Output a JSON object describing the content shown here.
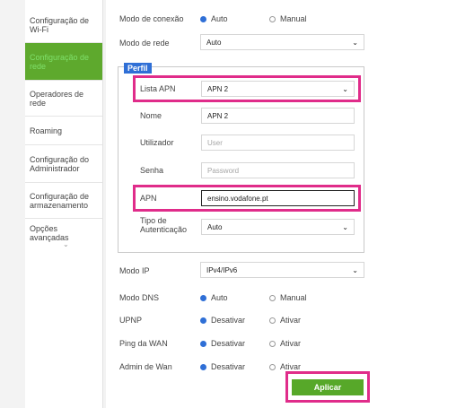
{
  "sidebar": {
    "items": [
      {
        "label": "Configuração de Wi-Fi"
      },
      {
        "label": "Configuração de rede"
      },
      {
        "label": "Operadores de rede"
      },
      {
        "label": "Roaming"
      },
      {
        "label": "Configuração do Administrador"
      },
      {
        "label": "Configuração de armazenamento"
      },
      {
        "label": "Opções avançadas"
      }
    ]
  },
  "form": {
    "connection_mode": {
      "label": "Modo de conexão",
      "options": [
        "Auto",
        "Manual"
      ],
      "selected": "Auto"
    },
    "network_mode": {
      "label": "Modo de rede",
      "value": "Auto"
    },
    "profile": {
      "legend": "Perfil",
      "apn_list": {
        "label": "Lista APN",
        "value": "APN 2"
      },
      "name": {
        "label": "Nome",
        "value": "APN 2"
      },
      "user": {
        "label": "Utilizador",
        "placeholder": "User"
      },
      "password": {
        "label": "Senha",
        "placeholder": "Password"
      },
      "apn": {
        "label": "APN",
        "value": "ensino.vodafone.pt"
      },
      "auth_type": {
        "label_line1": "Tipo de",
        "label_line2": "Autenticação",
        "value": "Auto"
      }
    },
    "ip_mode": {
      "label": "Modo IP",
      "value": "IPv4/IPv6"
    },
    "dns_mode": {
      "label": "Modo DNS",
      "options": [
        "Auto",
        "Manual"
      ],
      "selected": "Auto"
    },
    "upnp": {
      "label": "UPNP",
      "options": [
        "Desativar",
        "Ativar"
      ],
      "selected": "Desativar"
    },
    "wan_ping": {
      "label": "Ping da WAN",
      "options": [
        "Desativar",
        "Ativar"
      ],
      "selected": "Desativar"
    },
    "wan_admin": {
      "label": "Admin de Wan",
      "options": [
        "Desativar",
        "Ativar"
      ],
      "selected": "Desativar"
    },
    "apply_label": "Aplicar"
  },
  "colors": {
    "accent": "#2f6fd6",
    "active_bg": "#5ea92d",
    "highlight": "#e02c8a",
    "apply": "#57a829"
  }
}
